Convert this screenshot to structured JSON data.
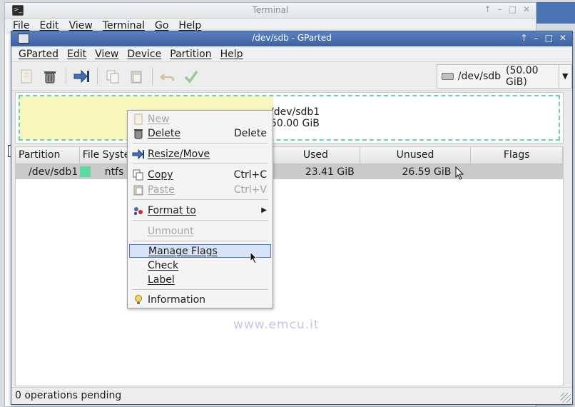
{
  "terminal": {
    "title": "Terminal",
    "menu": [
      "File",
      "Edit",
      "View",
      "Terminal",
      "Go",
      "Help"
    ]
  },
  "gparted": {
    "title": "/dev/sdb - GParted",
    "menu": [
      "GParted",
      "Edit",
      "View",
      "Device",
      "Partition",
      "Help"
    ],
    "device_selector": {
      "device": "/dev/sdb",
      "size": "(50.00 GiB)"
    },
    "disk_map": {
      "partition": "/dev/sdb1",
      "size": "50.00 GiB",
      "used_fraction": 0.47
    },
    "table": {
      "columns": [
        "Partition",
        "File System",
        "Used",
        "Unused",
        "Flags"
      ],
      "rows": [
        {
          "partition": "/dev/sdb1",
          "filesystem": "ntfs",
          "used": "23.41 GiB",
          "unused": "26.59 GiB",
          "flags": ""
        }
      ]
    },
    "status": "0 operations pending"
  },
  "context_menu": {
    "items": [
      {
        "label": "New",
        "accel": "",
        "disabled": true,
        "icon": "new-icon"
      },
      {
        "label": "Delete",
        "accel": "Delete",
        "disabled": false,
        "icon": "trash-icon"
      },
      {
        "label": "Resize/Move",
        "accel": "",
        "disabled": false,
        "icon": "resize-move-icon"
      },
      {
        "label": "Copy",
        "accel": "Ctrl+C",
        "disabled": false,
        "icon": "copy-icon"
      },
      {
        "label": "Paste",
        "accel": "Ctrl+V",
        "disabled": true,
        "icon": "paste-icon"
      },
      {
        "label": "Format to",
        "accel": "",
        "disabled": false,
        "icon": "format-icon",
        "submenu": true
      },
      {
        "label": "Unmount",
        "accel": "",
        "disabled": true,
        "icon": ""
      },
      {
        "label": "Manage Flags",
        "accel": "",
        "disabled": false,
        "highlighted": true,
        "icon": ""
      },
      {
        "label": "Check",
        "accel": "",
        "disabled": false,
        "icon": ""
      },
      {
        "label": "Label",
        "accel": "",
        "disabled": false,
        "icon": ""
      },
      {
        "label": "Information",
        "accel": "",
        "disabled": false,
        "icon": "info-bulb-icon"
      }
    ]
  },
  "watermark": "www.emcu.it",
  "colors": {
    "ntfs": "#5fd9a3",
    "used_space": "#f8f6bd",
    "titlebar": "#4a70b2",
    "highlight": "#d6e3f6"
  }
}
